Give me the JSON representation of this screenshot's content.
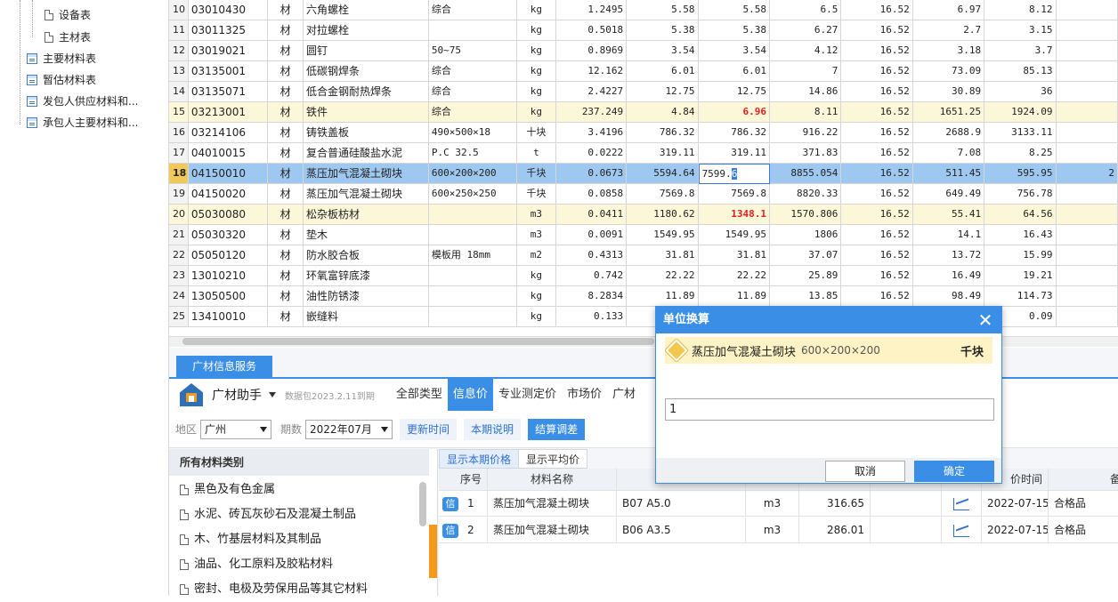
{
  "tree": {
    "items": [
      {
        "label": "设备表",
        "icon": "document-icon"
      },
      {
        "label": "主材表",
        "icon": "document-icon"
      },
      {
        "label": "主要材料表",
        "icon": "table-icon"
      },
      {
        "label": "暂估材料表",
        "icon": "table-icon"
      },
      {
        "label": "发包人供应材料和...",
        "icon": "table-icon"
      },
      {
        "label": "承包人主要材料和...",
        "icon": "table-icon"
      }
    ]
  },
  "grid": {
    "rows": [
      {
        "no": "10",
        "code": "03010430",
        "type": "材",
        "name": "六角螺栓",
        "spec": "综合",
        "unit": "kg",
        "qty": "1.2495",
        "p1": "5.58",
        "p2": "5.58",
        "p3": "6.5",
        "rate": "16.52",
        "a1": "6.97",
        "a2": "8.12"
      },
      {
        "no": "11",
        "code": "03011325",
        "type": "材",
        "name": "对拉螺栓",
        "spec": "",
        "unit": "kg",
        "qty": "0.5018",
        "p1": "5.38",
        "p2": "5.38",
        "p3": "6.27",
        "rate": "16.52",
        "a1": "2.7",
        "a2": "3.15"
      },
      {
        "no": "12",
        "code": "03019021",
        "type": "材",
        "name": "圆钉",
        "spec": "50~75",
        "unit": "kg",
        "qty": "0.8969",
        "p1": "3.54",
        "p2": "3.54",
        "p3": "4.12",
        "rate": "16.52",
        "a1": "3.18",
        "a2": "3.7"
      },
      {
        "no": "13",
        "code": "03135001",
        "type": "材",
        "name": "低碳钢焊条",
        "spec": "综合",
        "unit": "kg",
        "qty": "12.162",
        "p1": "6.01",
        "p2": "6.01",
        "p3": "7",
        "rate": "16.52",
        "a1": "73.09",
        "a2": "85.13"
      },
      {
        "no": "14",
        "code": "03135071",
        "type": "材",
        "name": "低合金钢耐热焊条",
        "spec": "综合",
        "unit": "kg",
        "qty": "2.4227",
        "p1": "12.75",
        "p2": "12.75",
        "p3": "14.86",
        "rate": "16.52",
        "a1": "30.89",
        "a2": "36"
      },
      {
        "no": "15",
        "code": "03213001",
        "type": "材",
        "name": "铁件",
        "spec": "综合",
        "unit": "kg",
        "qty": "237.249",
        "p1": "4.84",
        "p2": "6.96",
        "p3": "8.11",
        "rate": "16.52",
        "a1": "1651.25",
        "a2": "1924.09"
      },
      {
        "no": "16",
        "code": "03214106",
        "type": "材",
        "name": "铸铁盖板",
        "spec": "490×500×18",
        "unit": "十块",
        "qty": "3.4196",
        "p1": "786.32",
        "p2": "786.32",
        "p3": "916.22",
        "rate": "16.52",
        "a1": "2688.9",
        "a2": "3133.11"
      },
      {
        "no": "17",
        "code": "04010015",
        "type": "材",
        "name": "复合普通硅酸盐水泥",
        "spec": "P.C 32.5",
        "unit": "t",
        "qty": "0.0222",
        "p1": "319.11",
        "p2": "319.11",
        "p3": "371.83",
        "rate": "16.52",
        "a1": "7.08",
        "a2": "8.25"
      },
      {
        "no": "18",
        "code": "04150010",
        "type": "材",
        "name": "蒸压加气混凝土砌块",
        "spec": "600×200×200",
        "unit": "千块",
        "qty": "0.0673",
        "p1": "5594.64",
        "p2": "7599.",
        "p2b": "6",
        "p3": "8855.054",
        "rate": "16.52",
        "a1": "511.45",
        "a2": "595.95",
        "extra": "2"
      },
      {
        "no": "19",
        "code": "04150020",
        "type": "材",
        "name": "蒸压加气混凝土砌块",
        "spec": "600×250×250",
        "unit": "千块",
        "qty": "0.0858",
        "p1": "7569.8",
        "p2": "7569.8",
        "p3": "8820.33",
        "rate": "16.52",
        "a1": "649.49",
        "a2": "756.78"
      },
      {
        "no": "20",
        "code": "05030080",
        "type": "材",
        "name": "松杂板枋材",
        "spec": "",
        "unit": "m3",
        "qty": "0.0411",
        "p1": "1180.62",
        "p2": "1348.1",
        "p3": "1570.806",
        "rate": "16.52",
        "a1": "55.41",
        "a2": "64.56"
      },
      {
        "no": "21",
        "code": "05030320",
        "type": "材",
        "name": "垫木",
        "spec": "",
        "unit": "m3",
        "qty": "0.0091",
        "p1": "1549.95",
        "p2": "1549.95",
        "p3": "1806",
        "rate": "16.52",
        "a1": "14.1",
        "a2": "16.43"
      },
      {
        "no": "22",
        "code": "05050120",
        "type": "材",
        "name": "防水胶合板",
        "spec": "模板用 18mm",
        "unit": "m2",
        "qty": "0.4313",
        "p1": "31.81",
        "p2": "31.81",
        "p3": "37.07",
        "rate": "16.52",
        "a1": "13.72",
        "a2": "15.99"
      },
      {
        "no": "23",
        "code": "13010210",
        "type": "材",
        "name": "环氧富锌底漆",
        "spec": "",
        "unit": "kg",
        "qty": "0.742",
        "p1": "22.22",
        "p2": "22.22",
        "p3": "25.89",
        "rate": "16.52",
        "a1": "16.49",
        "a2": "19.21"
      },
      {
        "no": "24",
        "code": "13050500",
        "type": "材",
        "name": "油性防锈漆",
        "spec": "",
        "unit": "kg",
        "qty": "8.2834",
        "p1": "11.89",
        "p2": "11.89",
        "p3": "13.85",
        "rate": "16.52",
        "a1": "98.49",
        "a2": "114.73"
      },
      {
        "no": "25",
        "code": "13410010",
        "type": "材",
        "name": "嵌缝料",
        "spec": "",
        "unit": "kg",
        "qty": "0.133",
        "p1": "",
        "p2": "",
        "p3": "",
        "rate": "",
        "a1": "",
        "a2": "0.09"
      }
    ]
  },
  "service_tab": "广材信息服务",
  "toolbar1": {
    "title": "广材助手",
    "sub": "数据包2023.2.11到期",
    "tabs": [
      "全部类型",
      "信息价",
      "专业测定价",
      "市场价",
      "广材"
    ]
  },
  "toolbar2": {
    "region_label": "地区",
    "region_value": "广州",
    "period_label": "期数",
    "period_value": "2022年07月",
    "btn_update": "更新时间",
    "btn_note": "本期说明",
    "btn_settle": "结算调差"
  },
  "categories": {
    "title": "所有材料类别",
    "items": [
      "黑色及有色金属",
      "水泥、砖瓦灰砂石及混凝土制品",
      "木、竹基层材料及其制品",
      "油品、化工原料及胶粘材料",
      "密封、电极及劳保用品等其它材料"
    ]
  },
  "price": {
    "tabs": [
      "显示本期价格",
      "显示平均价"
    ],
    "headers": [
      "序号",
      "材料名称",
      "",
      "",
      "",
      "",
      "",
      "价时间",
      "备注"
    ],
    "rows": [
      {
        "badge": "信",
        "no": "1",
        "name": "蒸压加气混凝土砌块",
        "spec": "B07 A5.0",
        "unit": "m3",
        "price": "316.65",
        "date": "2022-07-15",
        "note": "合格品"
      },
      {
        "badge": "信",
        "no": "2",
        "name": "蒸压加气混凝土砌块",
        "spec": "B06 A3.5",
        "unit": "m3",
        "price": "286.01",
        "date": "2022-07-15",
        "note": "合格品"
      }
    ]
  },
  "dialog": {
    "title": "单位换算",
    "close": "✕",
    "name": "蒸压加气混凝土砌块",
    "spec": "600×200×200",
    "unit": "千块",
    "input_value": "1",
    "cancel": "取消",
    "ok": "确定"
  }
}
